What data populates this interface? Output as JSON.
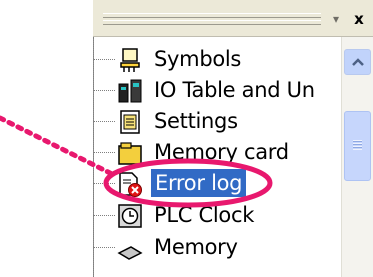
{
  "window": {
    "dropdown_glyph": "▾",
    "close_glyph": "x"
  },
  "tree": {
    "items": [
      {
        "label": "Symbols",
        "icon": "symbols-icon"
      },
      {
        "label": "IO Table and Un",
        "icon": "io-table-icon"
      },
      {
        "label": "Settings",
        "icon": "settings-icon"
      },
      {
        "label": "Memory card",
        "icon": "memory-card-icon"
      },
      {
        "label": "Error log",
        "icon": "error-log-icon",
        "selected": true
      },
      {
        "label": "PLC Clock",
        "icon": "plc-clock-icon"
      },
      {
        "label": "Memory",
        "icon": "memory-icon"
      }
    ]
  },
  "colors": {
    "selection": "#316ac5",
    "highlight_ring": "#e8186e",
    "callout_dots": "#e8186e"
  }
}
